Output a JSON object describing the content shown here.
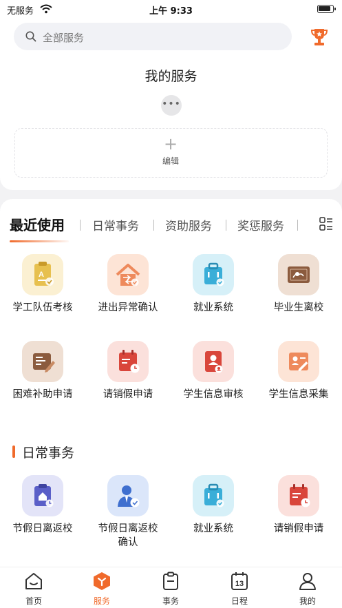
{
  "status_bar": {
    "carrier": "无服务",
    "time": "上午 9:33"
  },
  "search": {
    "placeholder": "全部服务",
    "icon": "search-icon"
  },
  "my_services": {
    "title": "我的服务",
    "more": "•••",
    "edit_label": "编辑",
    "edit_icon": "plus-icon"
  },
  "tabs": [
    {
      "label": "最近使用",
      "active": true
    },
    {
      "label": "日常事务",
      "active": false
    },
    {
      "label": "资助服务",
      "active": false
    },
    {
      "label": "奖惩服务",
      "active": false
    }
  ],
  "recent": [
    {
      "label": "学工队伍考核",
      "icon": "clipboard-grade-icon",
      "color": "#e7c04f"
    },
    {
      "label": "进出异常确认",
      "icon": "house-arrow-icon",
      "color": "#ee8a5c"
    },
    {
      "label": "就业系统",
      "icon": "briefcase-icon",
      "color": "#3aaed8"
    },
    {
      "label": "毕业生离校",
      "icon": "certificate-icon",
      "color": "#8b5b3e"
    },
    {
      "label": "困难补助申请",
      "icon": "form-pen-icon",
      "color": "#8b5b3e"
    },
    {
      "label": "请销假申请",
      "icon": "calendar-clock-icon",
      "color": "#d9463b"
    },
    {
      "label": "学生信息审核",
      "icon": "id-card-check-icon",
      "color": "#d9463b"
    },
    {
      "label": "学生信息采集",
      "icon": "id-card-edit-icon",
      "color": "#ee8a5c"
    }
  ],
  "daily": {
    "title": "日常事务",
    "items": [
      {
        "label": "节假日离返校",
        "icon": "clipboard-home-icon",
        "color": "#5a5fc8"
      },
      {
        "label": "节假日离返校\n确认",
        "icon": "person-check-icon",
        "color": "#3f6fcf"
      },
      {
        "label": "就业系统",
        "icon": "briefcase-icon",
        "color": "#3aaed8"
      },
      {
        "label": "请销假申请",
        "icon": "calendar-clock-icon",
        "color": "#d9463b"
      }
    ]
  },
  "tabbar": [
    {
      "label": "首页",
      "icon": "home-icon",
      "active": false
    },
    {
      "label": "服务",
      "icon": "service-cube-icon",
      "active": true
    },
    {
      "label": "事务",
      "icon": "clipboard-icon",
      "active": false
    },
    {
      "label": "日程",
      "icon": "calendar-icon",
      "active": false,
      "date": "13"
    },
    {
      "label": "我的",
      "icon": "user-icon",
      "active": false
    }
  ],
  "colors": {
    "accent": "#f06a2b"
  }
}
